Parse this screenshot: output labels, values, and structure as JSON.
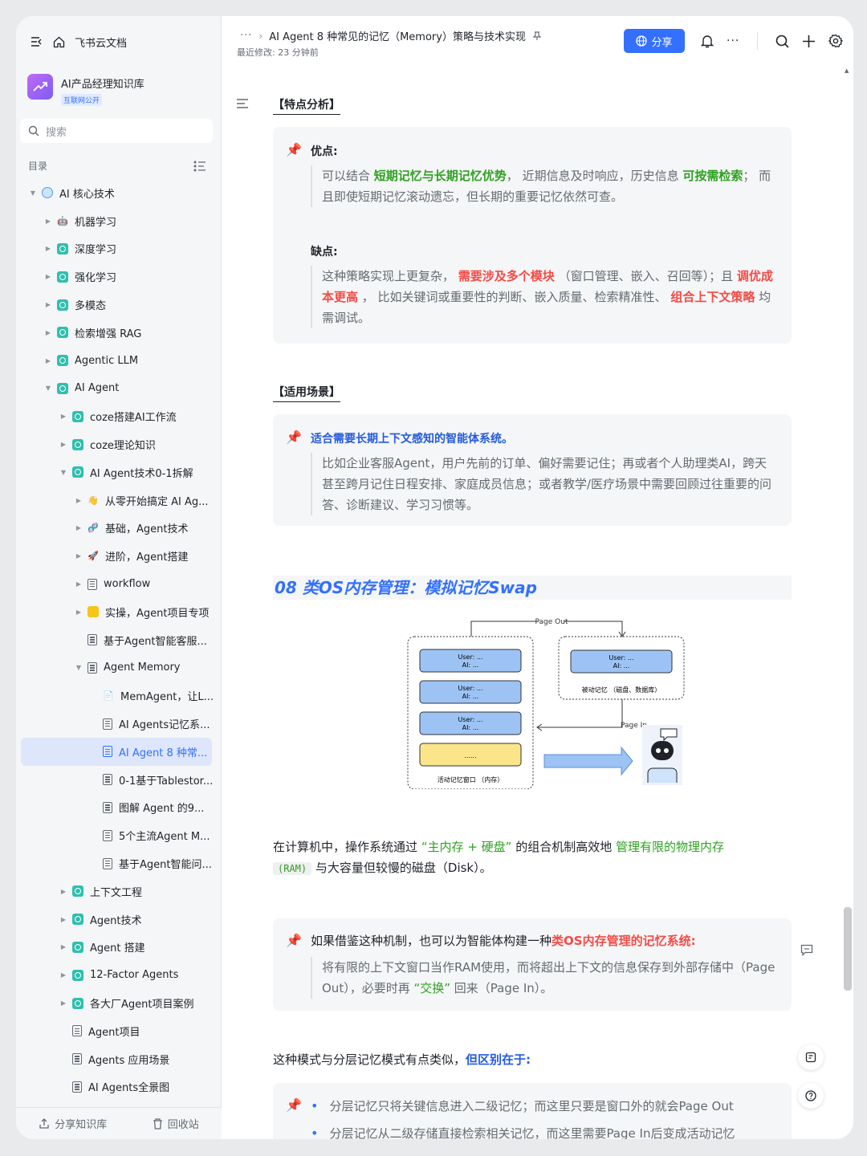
{
  "app": {
    "name": "飞书云文档"
  },
  "kb": {
    "name": "AI产品经理知识库",
    "badge": "互联网公开"
  },
  "search": {
    "placeholder": "搜索"
  },
  "toc": {
    "label": "目录"
  },
  "tree": [
    {
      "label": "AI 核心技术",
      "icon": "globe",
      "level": 0,
      "arrow": "▼"
    },
    {
      "label": "机器学习",
      "icon": "emoji-robot",
      "level": 1,
      "arrow": "▶"
    },
    {
      "label": "深度学习",
      "icon": "teal",
      "level": 1,
      "arrow": "▶"
    },
    {
      "label": "强化学习",
      "icon": "teal",
      "level": 1,
      "arrow": "▶"
    },
    {
      "label": "多模态",
      "icon": "teal",
      "level": 1,
      "arrow": "▶"
    },
    {
      "label": "检索增强 RAG",
      "icon": "teal",
      "level": 1,
      "arrow": "▶"
    },
    {
      "label": "Agentic LLM",
      "icon": "teal",
      "level": 1,
      "arrow": "▶"
    },
    {
      "label": "AI Agent",
      "icon": "teal",
      "level": 1,
      "arrow": "▼"
    },
    {
      "label": "coze搭建AI工作流",
      "icon": "teal",
      "level": 2,
      "arrow": "▶"
    },
    {
      "label": "coze理论知识",
      "icon": "teal",
      "level": 2,
      "arrow": "▶"
    },
    {
      "label": "AI Agent技术0-1拆解",
      "icon": "teal",
      "level": 2,
      "arrow": "▼"
    },
    {
      "label": "从零开始搞定 AI Ag...",
      "icon": "emoji-hand",
      "level": 3,
      "arrow": "▶"
    },
    {
      "label": "基础，Agent技术",
      "icon": "emoji-dna",
      "level": 3,
      "arrow": "▶"
    },
    {
      "label": "进阶，Agent搭建",
      "icon": "emoji-rocket",
      "level": 3,
      "arrow": "▶"
    },
    {
      "label": "workflow",
      "icon": "doc",
      "level": 3,
      "arrow": "▶"
    },
    {
      "label": "实操，Agent项目专项",
      "icon": "yellow",
      "level": 3,
      "arrow": "▶"
    },
    {
      "label": "基于Agent智能客服...",
      "icon": "doc",
      "level": 3,
      "arrow": ""
    },
    {
      "label": "Agent Memory",
      "icon": "doc",
      "level": 3,
      "arrow": "▼"
    },
    {
      "label": "MemAgent，让L...",
      "icon": "emoji-page",
      "level": 4,
      "arrow": ""
    },
    {
      "label": "AI Agents记忆系...",
      "icon": "doc",
      "level": 4,
      "arrow": ""
    },
    {
      "label": "AI Agent 8 种常...",
      "icon": "doc-blue",
      "level": 4,
      "arrow": "",
      "active": true
    },
    {
      "label": "0-1基于Tablestor...",
      "icon": "doc",
      "level": 4,
      "arrow": ""
    },
    {
      "label": "图解 Agent 的9...",
      "icon": "doc",
      "level": 4,
      "arrow": ""
    },
    {
      "label": "5个主流Agent M...",
      "icon": "doc",
      "level": 4,
      "arrow": ""
    },
    {
      "label": "基于Agent智能问...",
      "icon": "doc",
      "level": 4,
      "arrow": ""
    },
    {
      "label": "上下文工程",
      "icon": "teal",
      "level": 2,
      "arrow": "▶"
    },
    {
      "label": "Agent技术",
      "icon": "teal",
      "level": 2,
      "arrow": "▶"
    },
    {
      "label": "Agent 搭建",
      "icon": "teal",
      "level": 2,
      "arrow": "▶"
    },
    {
      "label": "12-Factor Agents",
      "icon": "teal",
      "level": 2,
      "arrow": "▶"
    },
    {
      "label": "各大厂Agent项目案例",
      "icon": "teal",
      "level": 2,
      "arrow": "▶"
    },
    {
      "label": "Agent项目",
      "icon": "doc",
      "level": 2,
      "arrow": ""
    },
    {
      "label": "Agents 应用场景",
      "icon": "doc",
      "level": 2,
      "arrow": ""
    },
    {
      "label": "AI Agents全景图",
      "icon": "doc",
      "level": 2,
      "arrow": ""
    }
  ],
  "sidebar_bottom": {
    "share": "分享知识库",
    "trash": "回收站"
  },
  "header": {
    "more": "···",
    "title": "AI Agent 8 种常见的记忆（Memory）策略与技术实现",
    "modified": "最近修改: 23 分钟前",
    "share": "分享"
  },
  "doc": {
    "h_features": "【特点分析】",
    "pros_title": "优点:",
    "pros": [
      "可以结合 ",
      "短期记忆与长期记忆优势",
      "， 近期信息及时响应，历史信息 ",
      "可按需检索",
      "； 而且即使短期记忆滚动遗忘，但长期的重要记忆依然可查。"
    ],
    "cons_title": "缺点:",
    "cons": [
      "这种策略实现上更复杂， ",
      "需要涉及多个模块",
      " （窗口管理、嵌入、召回等）；且 ",
      "调优成本更高",
      " ， 比如关键词或重要性的判断、嵌入质量、检索精准性、 ",
      "组合上下文策略",
      " 均需调试。"
    ],
    "h_scenarios": "【适用场景】",
    "scene_title": "适合需要长期上下文感知的智能体系统。",
    "scene_body": "比如企业客服Agent，用户先前的订单、偏好需要记住；再或者个人助理类AI，跨天甚至跨月记住日程安排、家庭成员信息；或者教学/医疗场景中需要回顾过往重要的问答、诊断建议、学习习惯等。",
    "h08": "08 类OS内存管理：模拟记忆Swap",
    "diagram": {
      "page_out": "Page Out",
      "page_in": "Page In",
      "user": "User: ...",
      "ai": "AI: ...",
      "dots": "......",
      "active_window": "活动记忆窗口 （内存）",
      "passive": "被动记忆 （磁盘、数据库）"
    },
    "para1": [
      "在计算机中，操作系统通过 ",
      "“主内存 + 硬盘”",
      " 的组合机制高效地 ",
      "管理有限的物理内存",
      "(RAM)",
      " 与大容量但较慢的磁盘（Disk）。"
    ],
    "callout2": [
      "如果借鉴这种机制，也可以为智能体构建一种",
      "类OS内存管理的记忆系统:"
    ],
    "callout2_body": [
      "将有限的上下文窗口当作RAM使用，而将超出上下文的信息保存到外部存储中（Page Out），必要时再 ",
      "“交换”",
      " 回来（Page In）。"
    ],
    "para2": [
      "这种模式与分层记忆模式有点类似，",
      "但区别在于:"
    ],
    "bullets": [
      "分层记忆只将关键信息进入二级记忆；而这里只要是窗口外的就会Page Out",
      "分层记忆从二级存储直接检索相关记忆，而这里需要Page In后变成活动记忆"
    ]
  },
  "colors": {
    "accent": "#3370ff",
    "green": "#2ea121",
    "red": "#f54a45"
  }
}
